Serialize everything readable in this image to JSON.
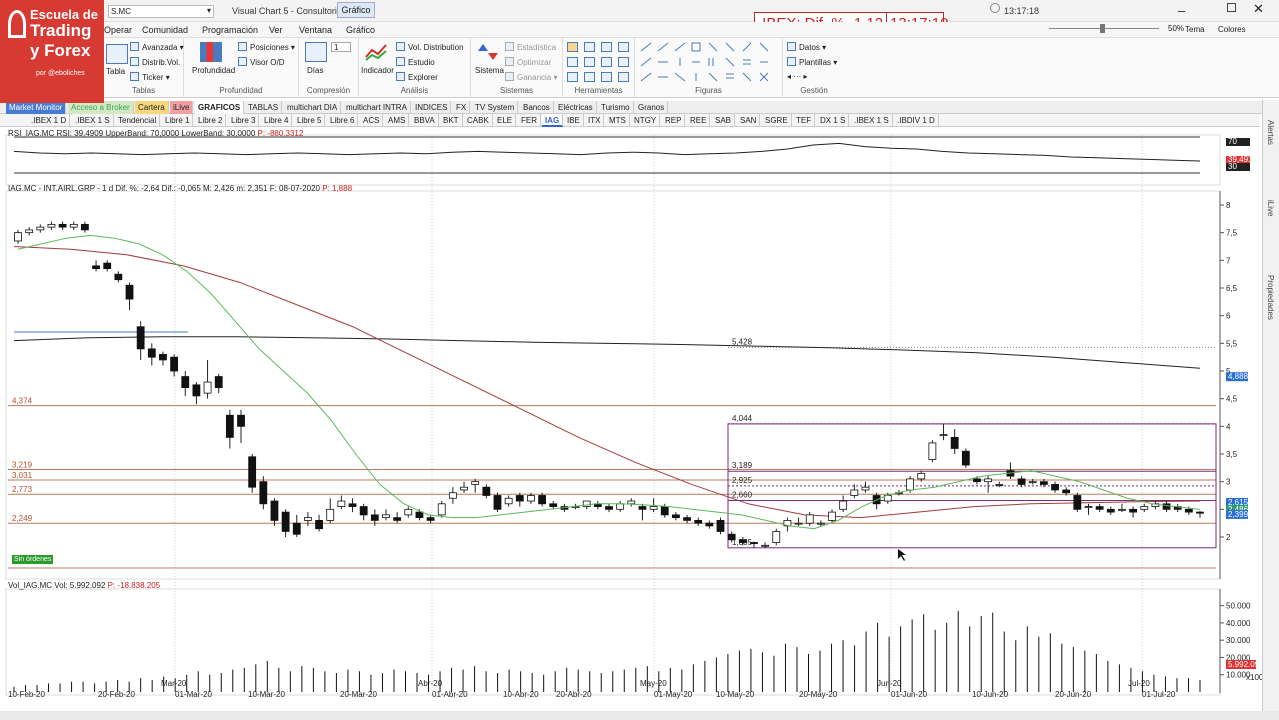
{
  "window": {
    "search": "S.MC",
    "title": "Visual Chart 5 - Consultorio",
    "context_tab": "Gráfico",
    "time": "13:17:18",
    "zoom": "50%",
    "theme": "Tema",
    "colors": "Colores"
  },
  "logo": {
    "line1": "Escuela de",
    "line2": "Trading",
    "line3": "y Forex",
    "line4": "por @eboliches"
  },
  "ibex": {
    "label": ".IBEX: Dif. % -1,12",
    "time": "13:17:10"
  },
  "menu": [
    "Operar",
    "Comunidad",
    "Programación",
    "Ver",
    "Ventana",
    "Gráfico"
  ],
  "ribbon": {
    "tablas": {
      "group": "Tablas",
      "big": "Tabla",
      "items": [
        "Avanzada",
        "Distrib.Vol.",
        "Ticker"
      ]
    },
    "profundidad": {
      "group": "Profundidad",
      "big": "Profundidad",
      "items": [
        "Posiciones",
        "Visor O/D"
      ]
    },
    "compresion": {
      "group": "Compresión",
      "big": "Días",
      "value": "1"
    },
    "analisis": {
      "group": "Análisis",
      "big": "Indicador",
      "items": [
        "Vol. Distribution",
        "Estudio",
        "Explorer"
      ]
    },
    "sistemas": {
      "group": "Sistemas",
      "big": "Sistema",
      "items": [
        "Estadística",
        "Optimizar",
        "Ganancia"
      ]
    },
    "herramientas": {
      "group": "Herramientas"
    },
    "figuras": {
      "group": "Figuras"
    },
    "gestion": {
      "group": "Gestión",
      "items": [
        "Datos",
        "Plantillas"
      ]
    }
  },
  "tabs1": [
    "Market Monitor",
    "Acceso a Broker",
    "Cartera",
    "iLive",
    "GRAFICOS",
    "TABLAS",
    "multichart DIA",
    "multichart INTRA",
    "INDICES",
    "FX",
    "TV System",
    "Bancos",
    "Eléctricas",
    "Turismo",
    "Granos"
  ],
  "tabs2": [
    ".IBEX 1 D",
    ".IBEX 1 S",
    "Tendencial",
    "Libre 1",
    "Libre 2",
    "Libre 3",
    "Libre 4",
    "Libre 5",
    "Libre 6",
    "ACS",
    "AMS",
    "BBVA",
    "BKT",
    "CABK",
    "ELE",
    "FER",
    "IAG",
    "IBE",
    "ITX",
    "MTS",
    "NTGY",
    "REP",
    "REE",
    "SAB",
    "SAN",
    "SGRE",
    "TEF",
    "DX 1 S",
    ".IBEX 1 S",
    ".IBDIV 1 D"
  ],
  "rsi": {
    "header": "RSI_IAG.MC  RSI: 39,4909  UpperBand: 70,0000  LowerBand: 30,0000",
    "p": "P: -880,3312",
    "ticks": [
      "70",
      "39,491",
      "30"
    ]
  },
  "price": {
    "header": "IAG.MC - INT.AIRL.GRP - 1 d  Dif. %: -2,64  Dif.: -0,065  M: 2,426  m: 2,351  F: 08-07-2020",
    "p": "P: 1,888",
    "ticks": [
      "8",
      "7,5",
      "7",
      "6,5",
      "6",
      "5,5",
      "5",
      "4,5",
      "4",
      "3,5",
      "3",
      "2,5",
      "2"
    ],
    "tags": [
      "4,888",
      "2,615",
      "2,486",
      "2,399"
    ],
    "levels": [
      "4,374",
      "3,219",
      "3,031",
      "2,773",
      "2,249"
    ],
    "fib": [
      "5,428",
      "4,044",
      "3,189",
      "2,925",
      "2,660",
      "1,805"
    ],
    "orders": "Sin órdenes"
  },
  "volume": {
    "header": "Vol_IAG.MC  Vol: 5.992.092",
    "p": "P: -18.838.205",
    "ticks": [
      "50.000",
      "40.000",
      "30.000",
      "20.000",
      "10.000"
    ],
    "tag": "5.992.092",
    "unit": "x1000"
  },
  "dates": [
    "10-Feb-20",
    "20-Feb-20",
    "01-Mar-20",
    "10-Mar-20",
    "20-Mar-20",
    "01-Abr-20",
    "10-Abr-20",
    "20-Abr-20",
    "01-May-20",
    "10-May-20",
    "20-May-20",
    "01-Jun-20",
    "10-Jun-20",
    "20-Jun-20",
    "01-Jul-20"
  ],
  "month_marks": [
    "Mar-20",
    "Abr-20",
    "May-20",
    "Jun-20",
    "Jul-20"
  ],
  "side": [
    "Alertas",
    "iLive",
    "Propiedades"
  ],
  "colors": {
    "logo": "#d63a33",
    "ibex": "#cc2222",
    "ma_green": "#5cb85c",
    "ma_red": "#a33b3b",
    "fib": "#7a2a7a",
    "hline": "#c08060",
    "price_tag": "#2a6fd6"
  }
}
